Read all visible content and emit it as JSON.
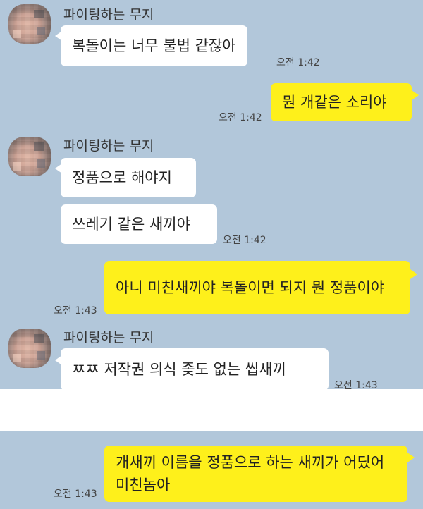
{
  "sender_name": "파이팅하는 무지",
  "messages": {
    "m1": {
      "text": "복돌이는 너무 불법 같잖아",
      "time": "오전 1:42"
    },
    "m2": {
      "text": "뭔 개같은 소리야",
      "time": "오전 1:42"
    },
    "m3": {
      "text": "정품으로 해야지"
    },
    "m4": {
      "text": "쓰레기 같은 새끼야",
      "time": "오전 1:42"
    },
    "m5": {
      "text": "아니 미친새끼야 복돌이면 되지 뭔 정품이야",
      "time": "오전 1:43"
    },
    "m6": {
      "text": "ㅉㅉ 저작권 의식 좆도 없는 씹새끼",
      "time": "오전 1:43"
    },
    "m7": {
      "text": "개새끼 이름을 정품으로 하는 새끼가 어딨어 미친놈아",
      "time": "오전 1:43"
    }
  },
  "colors": {
    "chat_bg": "#b2c7da",
    "outgoing_bubble": "#fef01b",
    "incoming_bubble": "#ffffff"
  },
  "icons": {
    "avatar": "blurred-profile-photo"
  }
}
